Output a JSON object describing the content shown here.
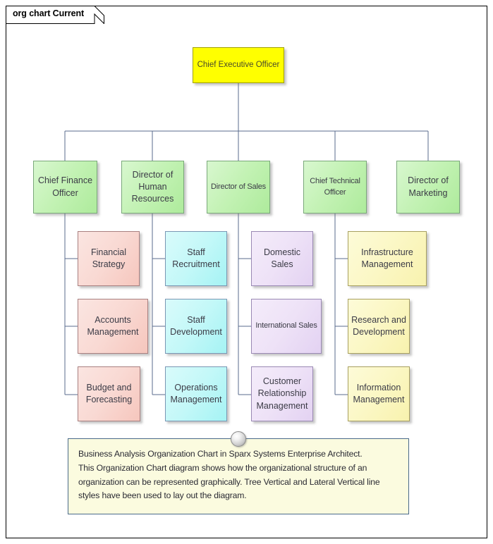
{
  "tab": {
    "label": "org chart Current"
  },
  "colors": {
    "ceo_fill": "#FFFF00",
    "level2_fill": "#C3F2B4",
    "finance_children_fill": "#F9D9D3",
    "hr_children_fill": "#C3F8F8",
    "sales_children_fill": "#EEE2F7",
    "tech_children_fill": "#FBF7C4",
    "note_fill": "#FBFBDF",
    "connector_line": "#5A6B8C",
    "frame_border": "#000000"
  },
  "chart_data": {
    "type": "diagram",
    "diagram_kind": "organization-chart",
    "line_styles": [
      "Tree Vertical",
      "Lateral Vertical"
    ],
    "root": {
      "id": "ceo",
      "label": "Chief Executive Officer"
    },
    "nodes": [
      {
        "id": "ceo",
        "label": "Chief Executive Officer",
        "level": 1,
        "color": "yellow",
        "parent": null
      },
      {
        "id": "cfo",
        "label": "Chief Finance Officer",
        "level": 2,
        "color": "green",
        "parent": "ceo"
      },
      {
        "id": "dhr",
        "label": "Director of Human Resources",
        "level": 2,
        "color": "green",
        "parent": "ceo"
      },
      {
        "id": "dos",
        "label": "Director of Sales",
        "level": 2,
        "color": "green",
        "parent": "ceo"
      },
      {
        "id": "cto",
        "label": "Chief Technical Officer",
        "level": 2,
        "color": "green",
        "parent": "ceo"
      },
      {
        "id": "dom",
        "label": "Director of Marketing",
        "level": 2,
        "color": "green",
        "parent": "ceo"
      },
      {
        "id": "fs",
        "label": "Financial Strategy",
        "level": 3,
        "color": "pink",
        "parent": "cfo"
      },
      {
        "id": "am",
        "label": "Accounts Management",
        "level": 3,
        "color": "pink",
        "parent": "cfo"
      },
      {
        "id": "bf",
        "label": "Budget and Forecasting",
        "level": 3,
        "color": "pink",
        "parent": "cfo"
      },
      {
        "id": "sr",
        "label": "Staff Recruitment",
        "level": 3,
        "color": "cyan",
        "parent": "dhr"
      },
      {
        "id": "sd",
        "label": "Staff Development",
        "level": 3,
        "color": "cyan",
        "parent": "dhr"
      },
      {
        "id": "om",
        "label": "Operations Management",
        "level": 3,
        "color": "cyan",
        "parent": "dhr"
      },
      {
        "id": "ds",
        "label": "Domestic Sales",
        "level": 3,
        "color": "purple",
        "parent": "dos"
      },
      {
        "id": "is",
        "label": "International Sales",
        "level": 3,
        "color": "purple",
        "parent": "dos"
      },
      {
        "id": "crm",
        "label": "Customer Relationship Management",
        "level": 3,
        "color": "purple",
        "parent": "dos"
      },
      {
        "id": "im",
        "label": "Infrastructure Management",
        "level": 3,
        "color": "yellow",
        "parent": "cto"
      },
      {
        "id": "rd",
        "label": "Research and Development",
        "level": 3,
        "color": "yellow",
        "parent": "cto"
      },
      {
        "id": "info",
        "label": "Information Management",
        "level": 3,
        "color": "yellow",
        "parent": "cto"
      }
    ]
  },
  "nodes": {
    "ceo": {
      "line1": "Chief Executive Officer"
    },
    "cfo": {
      "line1": "Chief Finance",
      "line2": "Officer"
    },
    "dhr": {
      "line1": "Director of",
      "line2": "Human",
      "line3": "Resources"
    },
    "dos": {
      "line1": "Director of Sales"
    },
    "cto": {
      "line1": "Chief Technical",
      "line2": "Officer"
    },
    "dom": {
      "line1": "Director of",
      "line2": "Marketing"
    },
    "fs": {
      "line1": "Financial",
      "line2": "Strategy"
    },
    "am": {
      "line1": "Accounts",
      "line2": "Management"
    },
    "bf": {
      "line1": "Budget and",
      "line2": "Forecasting"
    },
    "sr": {
      "line1": "Staff",
      "line2": "Recruitment"
    },
    "sd": {
      "line1": "Staff",
      "line2": "Development"
    },
    "om": {
      "line1": "Operations",
      "line2": "Management"
    },
    "ds": {
      "line1": "Domestic Sales"
    },
    "is": {
      "line1": "International Sales"
    },
    "crm": {
      "line1": "Customer",
      "line2": "Relationship",
      "line3": "Management"
    },
    "im": {
      "line1": "Infrastructure",
      "line2": "Management"
    },
    "rd": {
      "line1": "Research and",
      "line2": "Development"
    },
    "info": {
      "line1": "Information",
      "line2": "Management"
    }
  },
  "note": {
    "line1": "Business Analysis Organization Chart in Sparx Systems Enterprise Architect.",
    "line2": "This Organization Chart diagram shows how the organizational structure of an",
    "line3": "organization can be represented graphically. Tree Vertical and Lateral Vertical line",
    "line4": "styles have been used to lay out the diagram."
  }
}
